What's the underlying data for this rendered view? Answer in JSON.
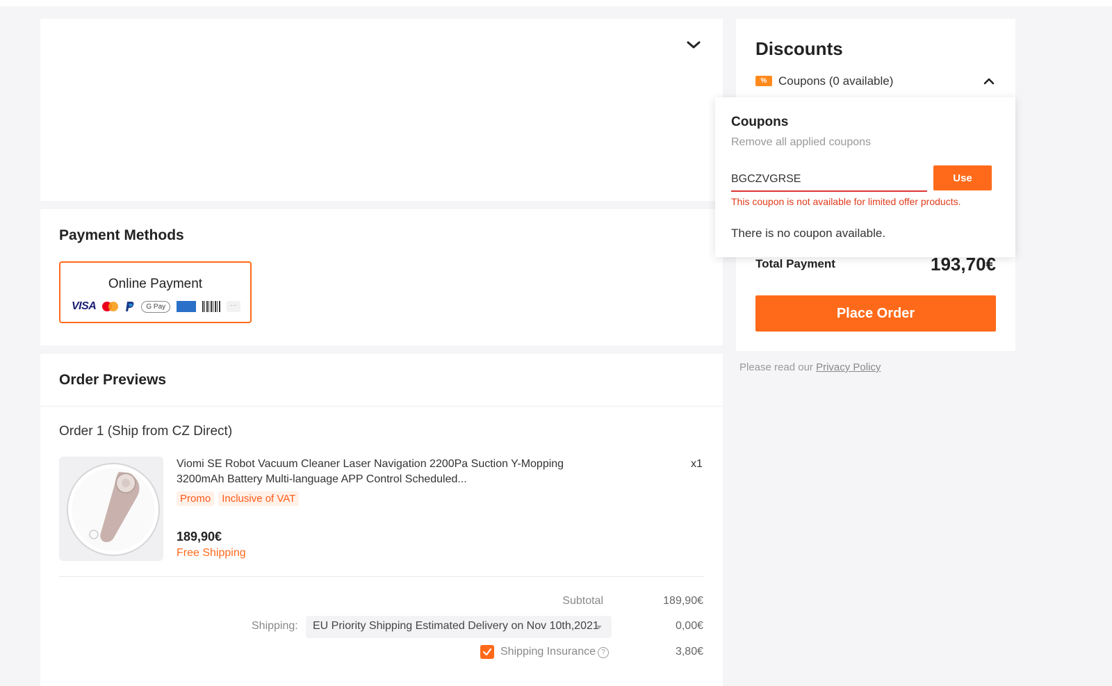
{
  "payment": {
    "title": "Payment Methods",
    "option_label": "Online Payment",
    "icons": [
      "visa-icon",
      "mastercard-icon",
      "paypal-icon",
      "google-pay-icon",
      "amex-icon",
      "boleto-icon",
      "more-icon"
    ],
    "visa_text": "VISA",
    "gpay_text": "G Pay",
    "more_text": "···"
  },
  "orders": {
    "title": "Order Previews",
    "order_title": "Order 1 (Ship from CZ Direct)",
    "product": {
      "name": "Viomi SE Robot Vacuum Cleaner Laser Navigation 2200Pa Suction Y-Mopping 3200mAh Battery Multi-language APP Control Scheduled...",
      "qty": "x1",
      "tags": [
        "Promo",
        "Inclusive of VAT"
      ],
      "price": "189,90€",
      "shipping_note": "Free Shipping"
    },
    "subtotal_label": "Subtotal",
    "subtotal_value": "189,90€",
    "shipping_label": "Shipping:",
    "shipping_method": "EU Priority Shipping Estimated Delivery on Nov 10th,2021",
    "shipping_value": "0,00€",
    "insurance_label": "Shipping Insurance",
    "insurance_checked": true,
    "insurance_value": "3,80€"
  },
  "discounts": {
    "title": "Discounts",
    "coupon_icon_text": "%",
    "coupons_label": "Coupons (0 available)",
    "total_label": "Total Payment",
    "total_value": "193,70€",
    "place_order": "Place Order"
  },
  "privacy": {
    "prefix": "Please read our ",
    "link": "Privacy Policy"
  },
  "coupon_popover": {
    "title": "Coupons",
    "remove_all": "Remove all applied coupons",
    "code_value": "BGCZVGRSE",
    "use_label": "Use",
    "error": "This coupon is not available for limited offer products.",
    "empty_text": "There is no coupon available."
  },
  "colors": {
    "accent": "#ff6a1a",
    "error": "#e03a1a",
    "background": "#f5f5f7"
  }
}
